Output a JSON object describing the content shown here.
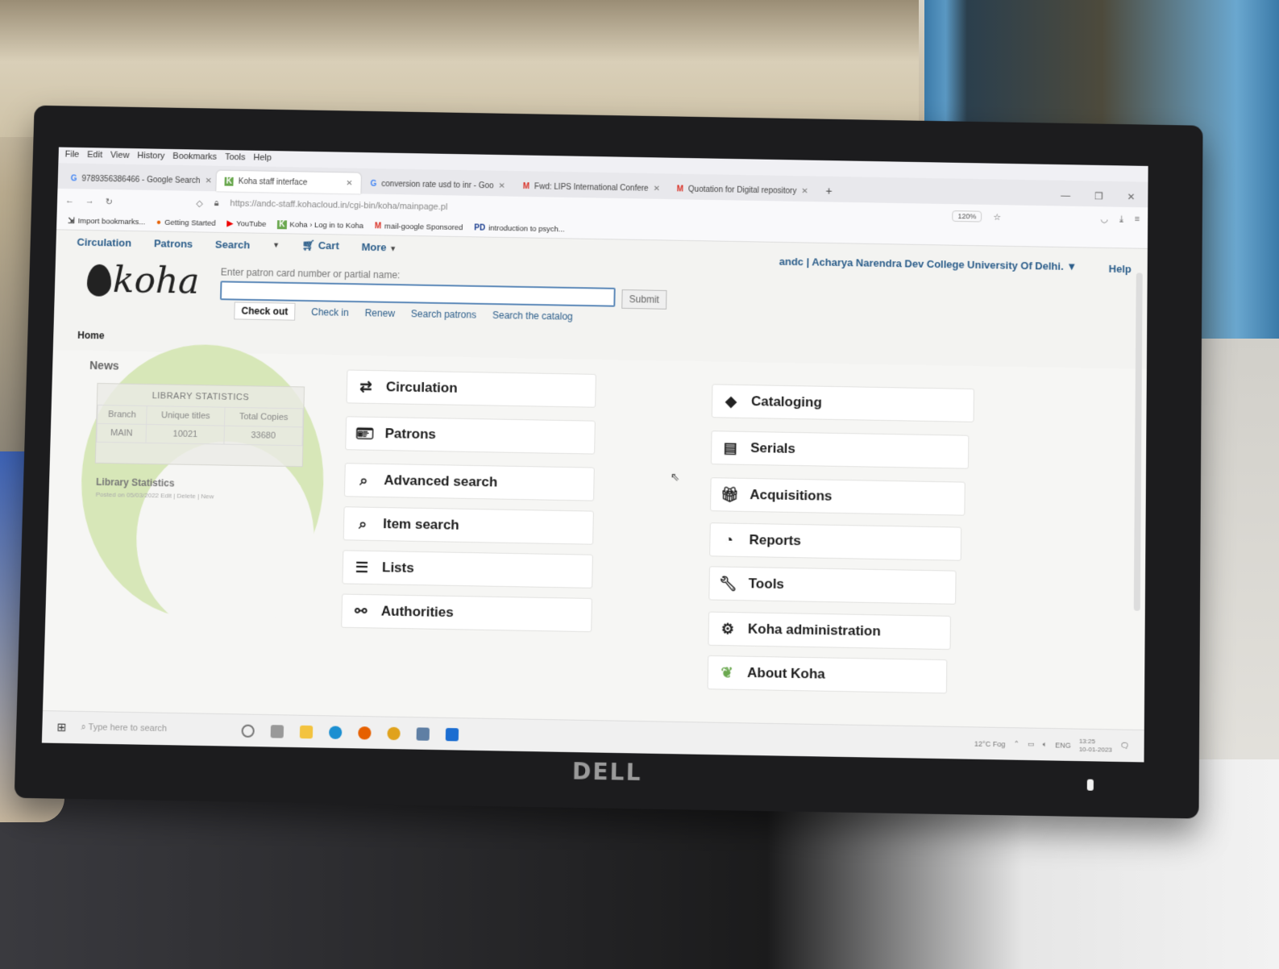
{
  "browser": {
    "menu": [
      "File",
      "Edit",
      "View",
      "History",
      "Bookmarks",
      "Tools",
      "Help"
    ],
    "tabs": [
      {
        "icon": "G",
        "label": "9789356386466 - Google Search"
      },
      {
        "icon": "K",
        "label": "Koha staff interface"
      },
      {
        "icon": "G",
        "label": "conversion rate usd to inr - Goo"
      },
      {
        "icon": "M",
        "label": "Fwd: LIPS International Confere"
      },
      {
        "icon": "M",
        "label": "Quotation for Digital repository"
      }
    ],
    "new_tab": "+",
    "url": "https://andc-staff.kohacloud.in/cgi-bin/koha/mainpage.pl",
    "zoom": "120%",
    "bookmarks": [
      {
        "icon": "⇲",
        "label": "Import bookmarks..."
      },
      {
        "icon": "●",
        "label": "Getting Started"
      },
      {
        "icon": "▶",
        "label": "YouTube"
      },
      {
        "icon": "K",
        "label": "Koha › Log in to Koha"
      },
      {
        "icon": "M",
        "label": "mail-google Sponsored"
      },
      {
        "icon": "PD",
        "label": "introduction to psych..."
      }
    ]
  },
  "koha": {
    "nav": {
      "circulation": "Circulation",
      "patrons": "Patrons",
      "search": "Search",
      "cart": "Cart",
      "more": "More"
    },
    "logged_in": "andc  |  Acharya Narendra Dev College University Of Delhi.",
    "help": "Help",
    "logo": "koha",
    "patron_label": "Enter patron card number or partial name:",
    "patron_value": "",
    "submit": "Submit",
    "tool_tabs": [
      "Check out",
      "Check in",
      "Renew",
      "Search patrons",
      "Search the catalog"
    ],
    "breadcrumb": "Home",
    "news": {
      "title": "News",
      "caption": "LIBRARY STATISTICS",
      "headers": [
        "Branch",
        "Unique titles",
        "Total Copies"
      ],
      "row": [
        "MAIN",
        "10021",
        "33680"
      ],
      "item_title": "Library Statistics",
      "posted": "Posted on 05/03/2022 Edit | Delete | New"
    },
    "modules_left": [
      {
        "label": "Circulation",
        "icon": "arrows-icon"
      },
      {
        "label": "Patrons",
        "icon": "id-card-icon"
      },
      {
        "label": "Advanced search",
        "icon": "search-icon"
      },
      {
        "label": "Item search",
        "icon": "search-icon"
      },
      {
        "label": "Lists",
        "icon": "list-icon"
      },
      {
        "label": "Authorities",
        "icon": "link-icon"
      }
    ],
    "modules_right": [
      {
        "label": "Cataloging",
        "icon": "tag-icon"
      },
      {
        "label": "Serials",
        "icon": "newspaper-icon"
      },
      {
        "label": "Acquisitions",
        "icon": "gift-icon"
      },
      {
        "label": "Reports",
        "icon": "pie-chart-icon"
      },
      {
        "label": "Tools",
        "icon": "wrench-icon"
      },
      {
        "label": "Koha administration",
        "icon": "gears-icon"
      },
      {
        "label": "About Koha",
        "icon": "koha-leaf-icon"
      }
    ]
  },
  "taskbar": {
    "search_placeholder": "Type here to search",
    "weather": "12°C  Fog",
    "lang": "ENG",
    "time": "13:25",
    "date": "10-01-2023"
  },
  "monitor": {
    "brand": "DELL"
  }
}
